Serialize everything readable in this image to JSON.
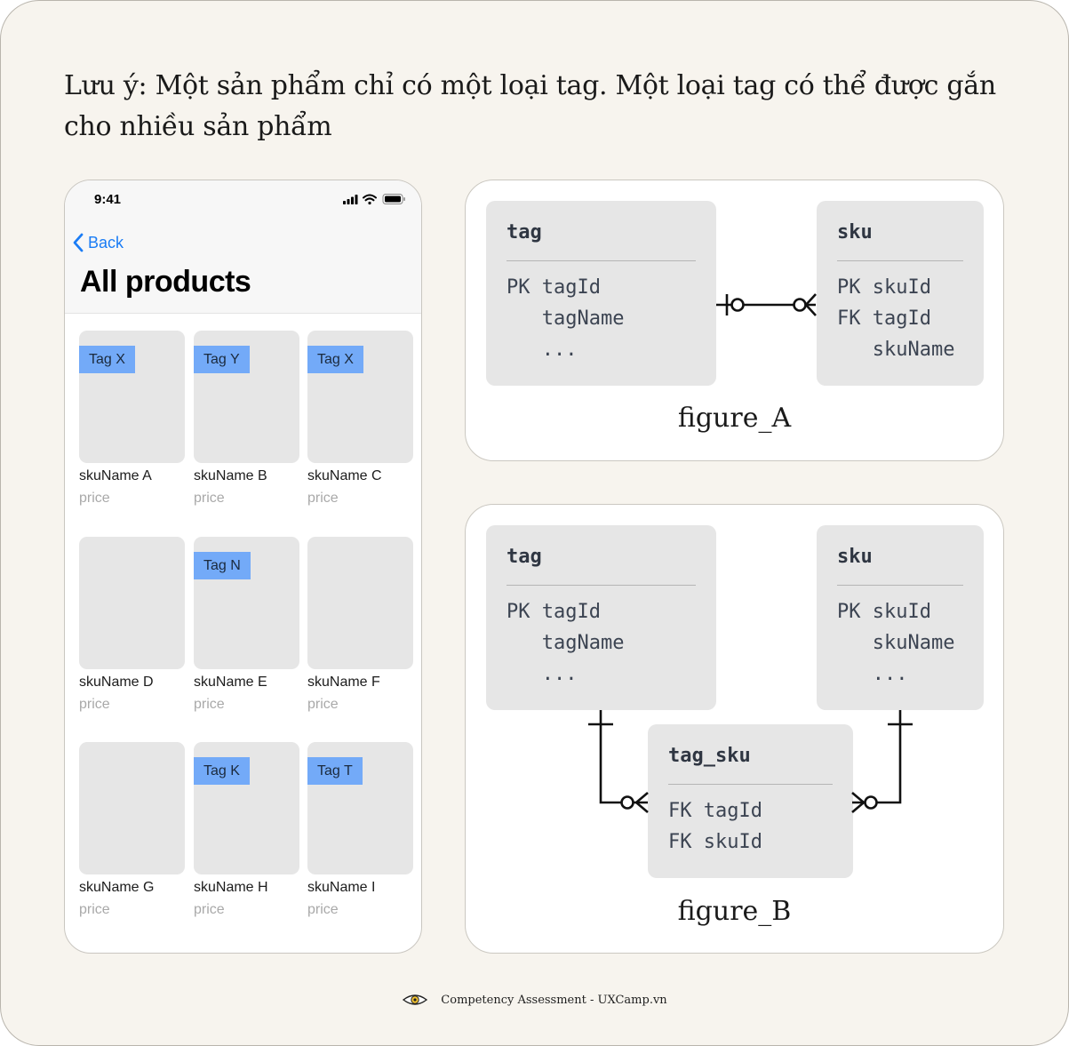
{
  "note": "Lưu ý: Một sản phẩm chỉ có một loại tag. Một loại tag có thể được gắn cho nhiều sản phẩm",
  "phone": {
    "time": "9:41",
    "back_label": "Back",
    "title": "All products",
    "products": [
      {
        "name": "skuName A",
        "price": "price",
        "tag": "Tag X"
      },
      {
        "name": "skuName B",
        "price": "price",
        "tag": "Tag Y"
      },
      {
        "name": "skuName C",
        "price": "price",
        "tag": "Tag X"
      },
      {
        "name": "skuName D",
        "price": "price",
        "tag": ""
      },
      {
        "name": "skuName E",
        "price": "price",
        "tag": "Tag N"
      },
      {
        "name": "skuName F",
        "price": "price",
        "tag": ""
      },
      {
        "name": "skuName G",
        "price": "price",
        "tag": ""
      },
      {
        "name": "skuName H",
        "price": "price",
        "tag": "Tag K"
      },
      {
        "name": "skuName I",
        "price": "price",
        "tag": "Tag T"
      }
    ]
  },
  "figure_a": {
    "caption": "figure_A",
    "tag": {
      "name": "tag",
      "rows": [
        "PK tagId",
        "   tagName",
        "   ..."
      ]
    },
    "sku": {
      "name": "sku",
      "rows": [
        "PK skuId",
        "FK tagId",
        "   skuName"
      ]
    }
  },
  "figure_b": {
    "caption": "figure_B",
    "tag": {
      "name": "tag",
      "rows": [
        "PK tagId",
        "   tagName",
        "   ..."
      ]
    },
    "sku": {
      "name": "sku",
      "rows": [
        "PK skuId",
        "   skuName",
        "   ..."
      ]
    },
    "tag_sku": {
      "name": "tag_sku",
      "rows": [
        "FK tagId",
        "FK skuId"
      ]
    }
  },
  "footer": {
    "text": "Competency Assessment - UXCamp.vn"
  },
  "colors": {
    "background": "#f7f4ee",
    "tag_badge": "#73aaf8",
    "link": "#1a7cf5",
    "entity": "#e6e6e6"
  }
}
